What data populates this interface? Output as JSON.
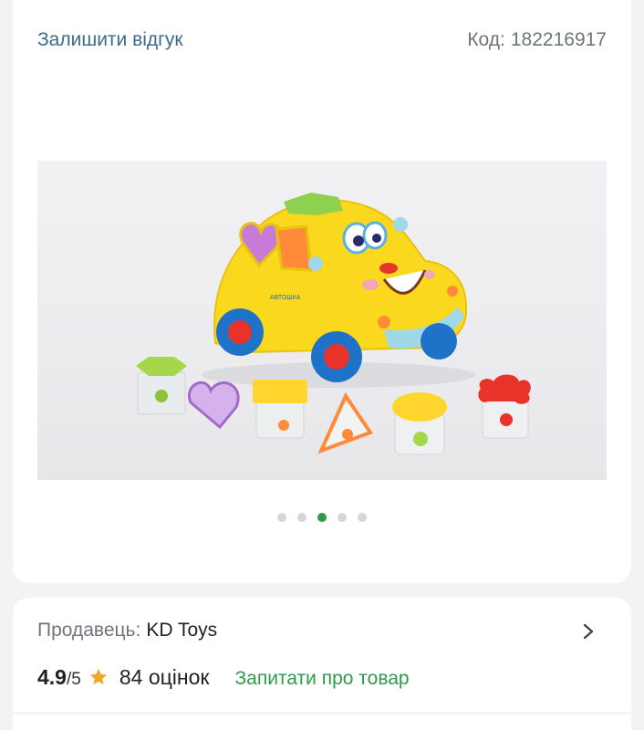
{
  "header": {
    "review_link": "Залишити відгук",
    "code_label": "Код:",
    "code_value": "182216917"
  },
  "gallery": {
    "dots": [
      {
        "active": false
      },
      {
        "active": false
      },
      {
        "active": true
      },
      {
        "active": false
      },
      {
        "active": false
      }
    ],
    "active_dot_color": "#2e9a4a",
    "inactive_dot_color": "#d4d6d8"
  },
  "seller": {
    "label": "Продавець:",
    "name": "KD Toys",
    "rating": "4.9",
    "rating_max": "/5",
    "reviews": "84 оцінок",
    "ask_link": "Запитати про товар",
    "chevron_icon": "chevron-right-icon",
    "star_icon": "star-icon",
    "star_color": "#f2a626"
  },
  "colors": {
    "link_blue": "#3d6b8a",
    "accent_green": "#2e9a4a",
    "muted_text": "#6f7478"
  }
}
